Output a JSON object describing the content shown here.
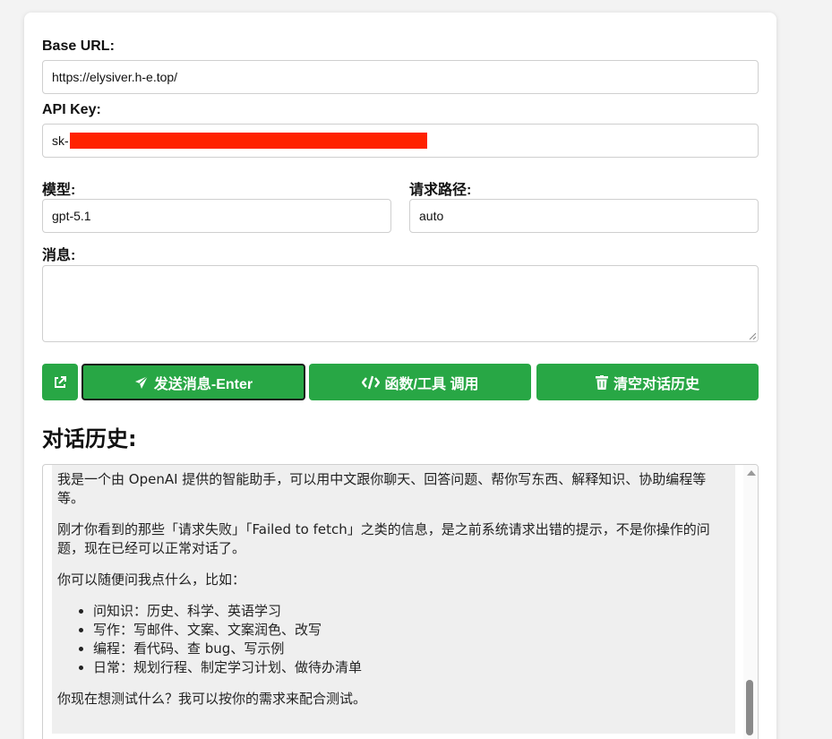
{
  "form": {
    "base_url_label": "Base URL:",
    "base_url_value": "https://elysiver.h-e.top/",
    "api_key_label": "API Key:",
    "api_key_value": "sk-",
    "model_label": "模型:",
    "model_value": "gpt-5.1",
    "path_label": "请求路径:",
    "path_value": "auto",
    "message_label": "消息:",
    "message_value": ""
  },
  "buttons": {
    "open_icon": "external-link-icon",
    "send_label": "发送消息-Enter",
    "send_icon": "paper-plane-icon",
    "function_label": "函数/工具 调用",
    "function_icon": "code-icon",
    "clear_label": "清空对话历史",
    "clear_icon": "trash-icon"
  },
  "history": {
    "title": "对话历史:",
    "paragraphs": [
      "我是一个由 OpenAI 提供的智能助手，可以用中文跟你聊天、回答问题、帮你写东西、解释知识、协助编程等等。",
      "刚才你看到的那些「请求失败」「Failed to fetch」之类的信息，是之前系统请求出错的提示，不是你操作的问题，现在已经可以正常对话了。",
      "你可以随便问我点什么，比如："
    ],
    "list": [
      "问知识：历史、科学、英语学习",
      "写作：写邮件、文案、文案润色、改写",
      "编程：看代码、查 bug、写示例",
      "日常：规划行程、制定学习计划、做待办清单"
    ],
    "closing": "你现在想测试什么？我可以按你的需求来配合测试。"
  },
  "colors": {
    "button_green": "#28a745",
    "redaction": "#ff2200",
    "message_bg": "#efefef"
  }
}
